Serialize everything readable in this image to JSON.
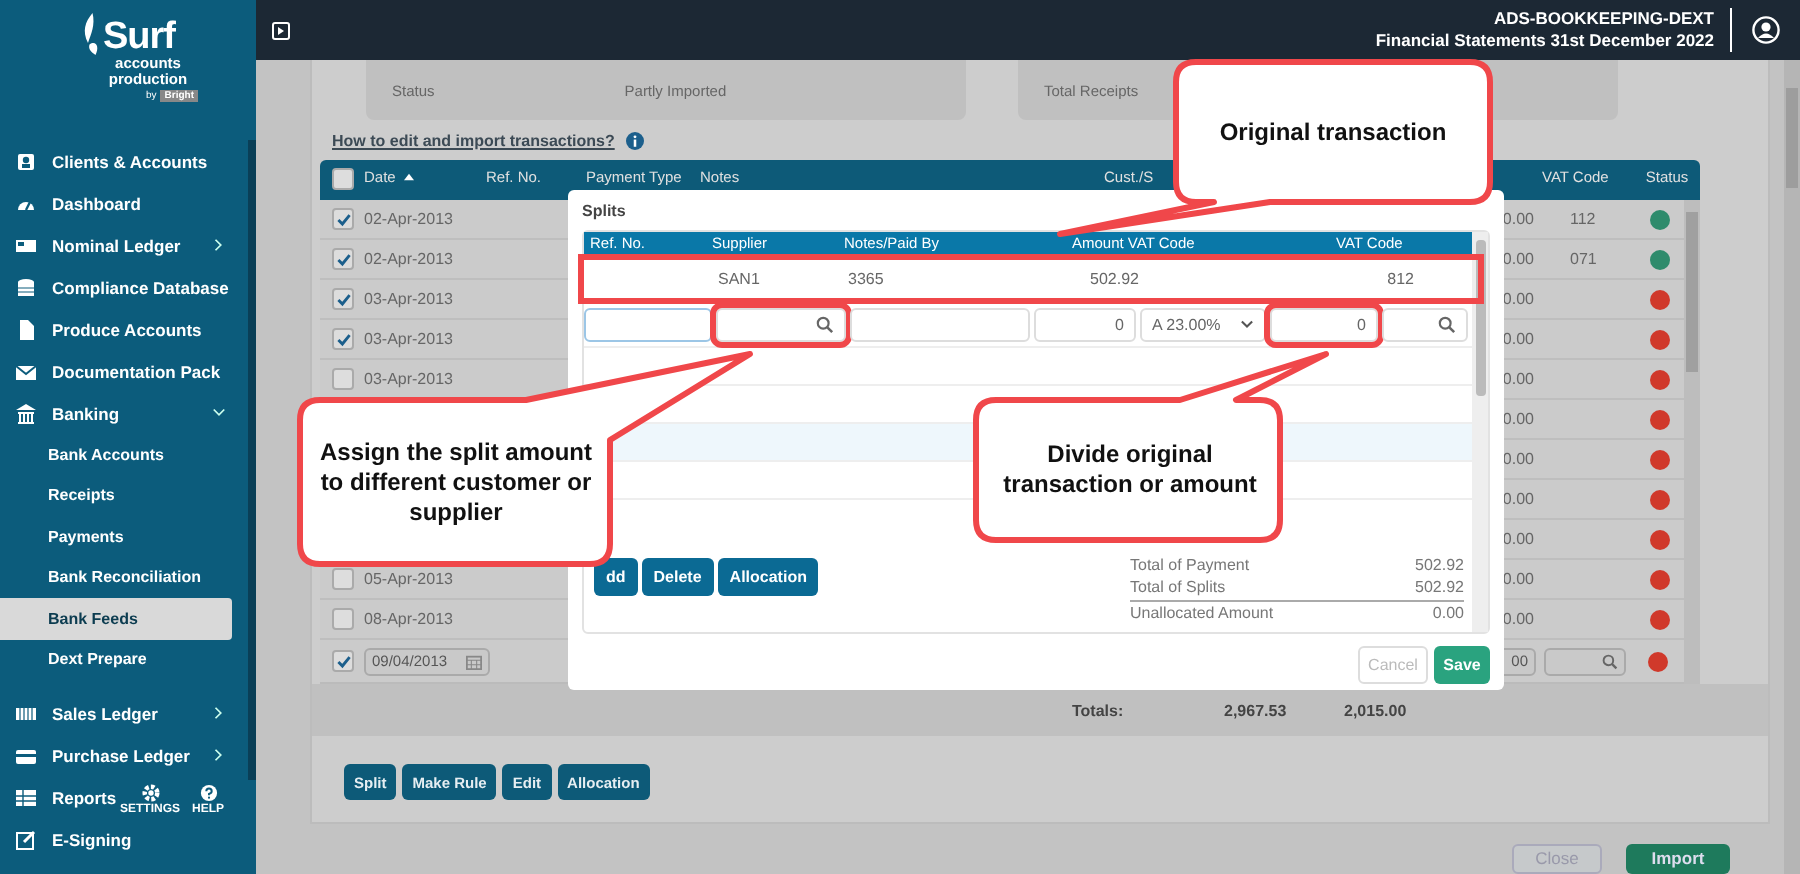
{
  "sidebar": {
    "logo": {
      "name": "Surf",
      "line_1": "accounts",
      "line_2": "production",
      "by": "by",
      "brand": "Bright"
    },
    "items": [
      {
        "label": "Clients & Accounts",
        "selected": false
      },
      {
        "label": "Dashboard",
        "selected": false
      },
      {
        "label": "Nominal Ledger",
        "selected": false,
        "expanded": false
      },
      {
        "label": "Compliance Database",
        "selected": false
      },
      {
        "label": "Produce Accounts",
        "selected": false
      },
      {
        "label": "Documentation Pack",
        "selected": false
      },
      {
        "label": "Banking",
        "selected": false,
        "expanded": true,
        "children": [
          {
            "label": "Bank Accounts",
            "selected": false
          },
          {
            "label": "Receipts",
            "selected": false
          },
          {
            "label": "Payments",
            "selected": false
          },
          {
            "label": "Bank Reconciliation",
            "selected": false
          },
          {
            "label": "Bank Feeds",
            "selected": true
          },
          {
            "label": "Dext Prepare",
            "selected": false
          }
        ]
      },
      {
        "label": "Sales Ledger",
        "selected": false,
        "expanded": false
      },
      {
        "label": "Purchase Ledger",
        "selected": false,
        "expanded": false
      },
      {
        "label": "Reports",
        "selected": false
      },
      {
        "label": "E-Signing",
        "selected": false
      }
    ],
    "footer": [
      {
        "label": "SETTINGS"
      },
      {
        "label": "HELP"
      }
    ]
  },
  "topbar": {
    "client": "ADS-BOOKKEEPING-DEXT",
    "period": "Financial Statements 31st December 2022"
  },
  "summary": [
    {
      "label": "Status",
      "value": "Partly Imported"
    },
    {
      "label": "Total Receipts"
    }
  ],
  "help_link": "How to edit and import transactions?",
  "table": {
    "select_all_checked": false,
    "columns": [
      {
        "label": "Date",
        "sorted": true
      },
      {
        "label": "Ref. No."
      },
      {
        "label": "Payment Type"
      },
      {
        "label": "Notes"
      },
      {
        "label": "Cust./S"
      },
      {
        "label": "VAT Code"
      },
      {
        "label": "Status"
      }
    ],
    "rows": [
      {
        "checked": true,
        "date": "02-Apr-2013",
        "amount": "0.00",
        "vat_code": "112",
        "color": "#2e8b6c"
      },
      {
        "checked": true,
        "date": "02-Apr-2013",
        "amount": "0.00",
        "vat_code": "071",
        "color": "#2e8b6c"
      },
      {
        "checked": true,
        "date": "03-Apr-2013",
        "amount": "0.00",
        "color": "#d0392b"
      },
      {
        "checked": true,
        "date": "03-Apr-2013",
        "amount": "0.00",
        "color": "#d0392b"
      },
      {
        "checked": false,
        "date": "03-Apr-2013",
        "amount": "0.00",
        "color": "#d0392b"
      },
      {
        "amount": "0.00",
        "color": "#d0392b"
      },
      {
        "amount": "0.00",
        "color": "#d0392b"
      },
      {
        "amount": "0.00",
        "color": "#d0392b"
      },
      {
        "amount": "0.00",
        "color": "#d0392b"
      },
      {
        "checked": false,
        "date": "05-Apr-2013",
        "amount": "0.00",
        "color": "#d0392b"
      },
      {
        "checked": false,
        "date": "08-Apr-2013",
        "amount": "0.00",
        "color": "#d0392b"
      }
    ],
    "edit_row": {
      "checked": true,
      "date": "09/04/2013",
      "amount": "00",
      "color": "#d0392b"
    },
    "totals": {
      "label": "Totals:",
      "values": [
        "2,967.53",
        "2,015.00"
      ]
    },
    "actions": [
      "Split",
      "Make Rule",
      "Edit",
      "Allocation"
    ]
  },
  "footer_buttons": [
    "Close",
    "Import"
  ],
  "modal": {
    "title": "Splits",
    "columns": [
      "Ref. No.",
      "Supplier",
      "Notes/Paid By",
      "Amount VAT Code",
      "VAT Code"
    ],
    "original": {
      "supplier": "SAN1",
      "notes": "3365",
      "amount": "502.92",
      "vat_code": "812"
    },
    "entry": {
      "amount": "0",
      "vat_rate": "A 23.00%",
      "split_amount": "0"
    },
    "blank_rows": [
      {
        "selected": false
      },
      {
        "selected": false
      },
      {
        "selected": true
      },
      {
        "selected": false
      }
    ],
    "buttons": [
      "dd",
      "Delete",
      "Allocation"
    ],
    "totals": [
      {
        "label": "Total of Payment",
        "value": "502.92"
      },
      {
        "label": "Total of Splits",
        "value": "502.92"
      },
      {
        "label": "Unallocated Amount",
        "value": "0.00"
      }
    ],
    "cancel": "Cancel",
    "save": "Save"
  },
  "callouts": [
    {
      "text": "Original transaction"
    },
    {
      "text": "Assign the split amount to different customer or supplier"
    },
    {
      "text": "Divide original transaction or amount"
    }
  ]
}
